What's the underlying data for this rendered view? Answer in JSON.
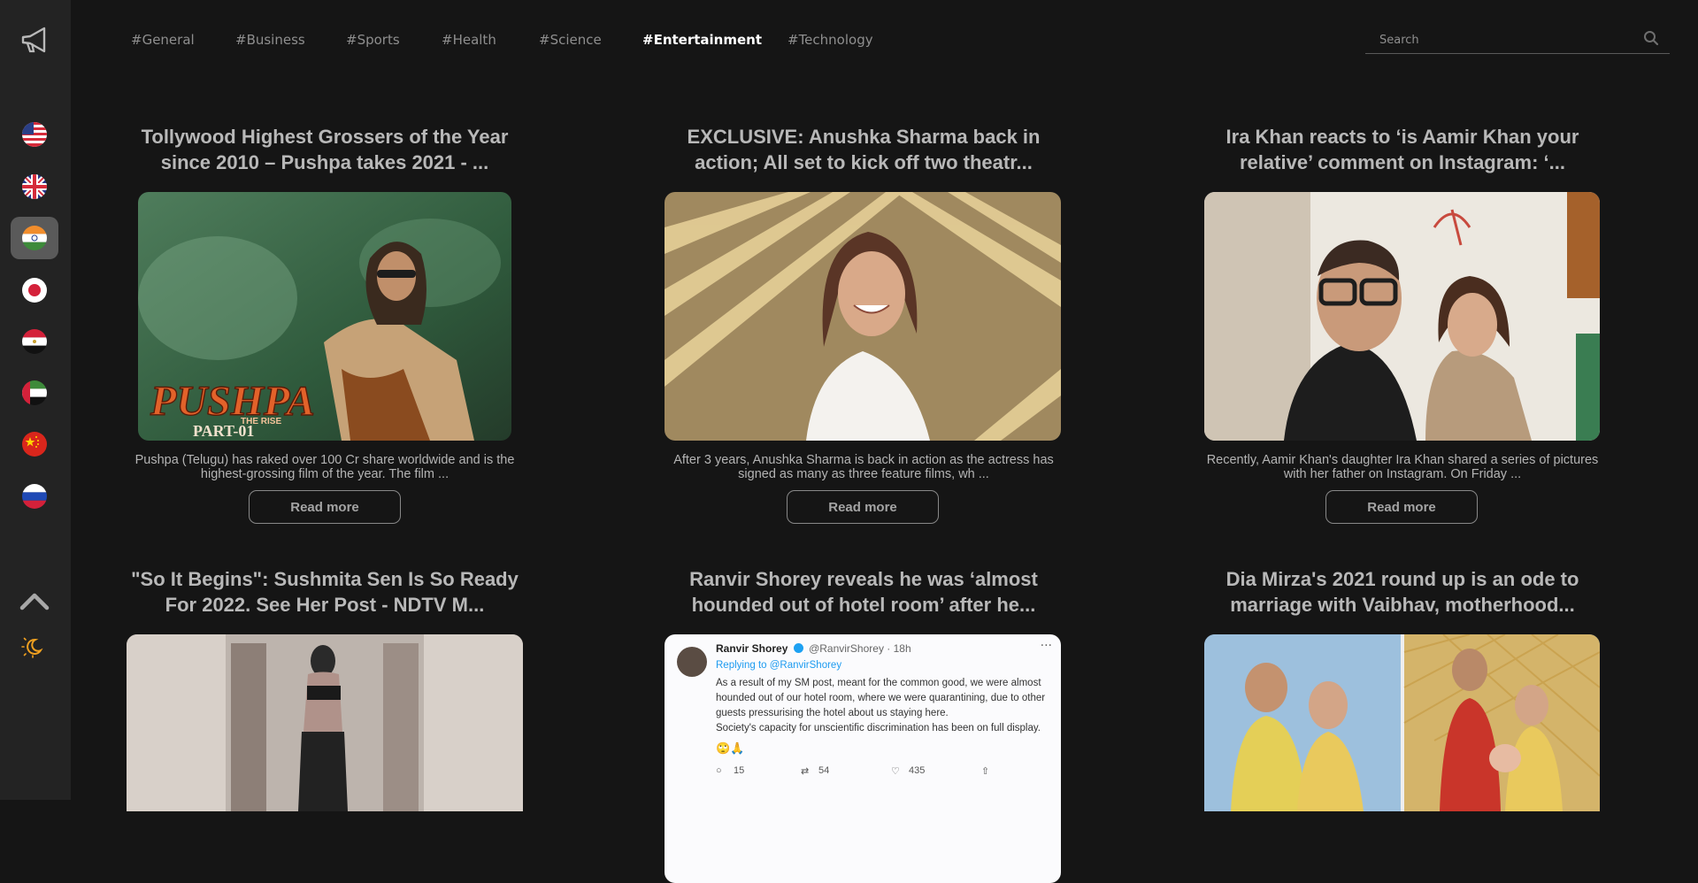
{
  "app": {
    "logo_icon": "megaphone-icon"
  },
  "sidebar": {
    "countries": [
      {
        "name": "United States",
        "icon": "us-flag-icon"
      },
      {
        "name": "United Kingdom",
        "icon": "uk-flag-icon"
      },
      {
        "name": "India",
        "icon": "india-flag-icon",
        "active": true
      },
      {
        "name": "Japan",
        "icon": "japan-flag-icon"
      },
      {
        "name": "Egypt",
        "icon": "egypt-flag-icon"
      },
      {
        "name": "United Arab Emirates",
        "icon": "uae-flag-icon"
      },
      {
        "name": "China",
        "icon": "china-flag-icon"
      },
      {
        "name": "Russia",
        "icon": "russia-flag-icon"
      }
    ],
    "scroll_top_icon": "chevron-up-icon",
    "theme_icon": "sun-moon-icon"
  },
  "nav": {
    "tabs": [
      "#General",
      "#Business",
      "#Sports",
      "#Health",
      "#Science",
      "#Entertainment",
      "#Technology"
    ],
    "active_tab": "#Entertainment"
  },
  "search": {
    "placeholder": "Search",
    "value": "",
    "icon": "search-icon"
  },
  "articles": [
    {
      "title": "Tollywood Highest Grossers of the Year since 2010 – Pushpa takes 2021 - ...",
      "description": "Pushpa (Telugu) has raked over 100 Cr share worldwide and is the highest-grossing film of the year. The film ...",
      "image_text": "PUSHPA",
      "image_subtext": "THE RISE",
      "image_part": "PART-01",
      "read_more": "Read more"
    },
    {
      "title": "EXCLUSIVE: Anushka Sharma back in action; All set to kick off two theatr...",
      "description": "After 3 years, Anushka Sharma is back in action as the actress has signed as many as three feature films, wh ...",
      "read_more": "Read more"
    },
    {
      "title": "Ira Khan reacts to ‘is Aamir Khan your relative’ comment on Instagram: ‘...",
      "description": "Recently, Aamir Khan's daughter Ira Khan shared a series of pictures with her father on Instagram. On Friday ...",
      "read_more": "Read more"
    },
    {
      "title": "\"So It Begins\": Sushmita Sen Is So Ready For 2022. See Her Post - NDTV M..."
    },
    {
      "title": "Ranvir Shorey reveals he was ‘almost hounded out of hotel room’ after he...",
      "tweet": {
        "name": "Ranvir Shorey",
        "handle": "@RanvirShorey · 18h",
        "replying": "Replying to @RanvirShorey",
        "line1": "As a result of my SM post, meant for the common good, we were almost",
        "line2": "hounded out of our hotel room, where we were quarantining, due to other",
        "line3": "guests pressurising the hotel about us staying here.",
        "line4": "Society's capacity for unscientific discrimination has been on full display.",
        "replies": "15",
        "retweets": "54",
        "likes": "435"
      }
    },
    {
      "title": "Dia Mirza's 2021 round up is an ode to marriage with Vaibhav, motherhood..."
    }
  ]
}
